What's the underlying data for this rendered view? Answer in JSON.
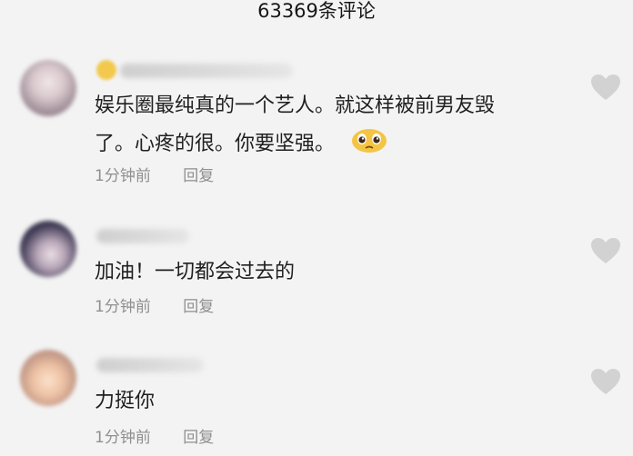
{
  "header": {
    "title": "63369条评论"
  },
  "comments": [
    {
      "lines": [
        "娱乐圈最纯真的一个艺人。就这样被前男友毁",
        "了。心疼的很。你要坚强。"
      ],
      "emoji": "pleading-face-icon",
      "time": "1分钟前",
      "reply": "回复"
    },
    {
      "lines": [
        "加油！一切都会过去的"
      ],
      "time": "1分钟前",
      "reply": "回复"
    },
    {
      "lines": [
        "力挺你"
      ],
      "time": "1分钟前",
      "reply": "回复"
    }
  ],
  "icons": {
    "like": "heart-icon"
  },
  "colors": {
    "background": "#f3f3f3",
    "meta_text": "#8f8f8f",
    "like_icon": "#d2d2d2"
  }
}
